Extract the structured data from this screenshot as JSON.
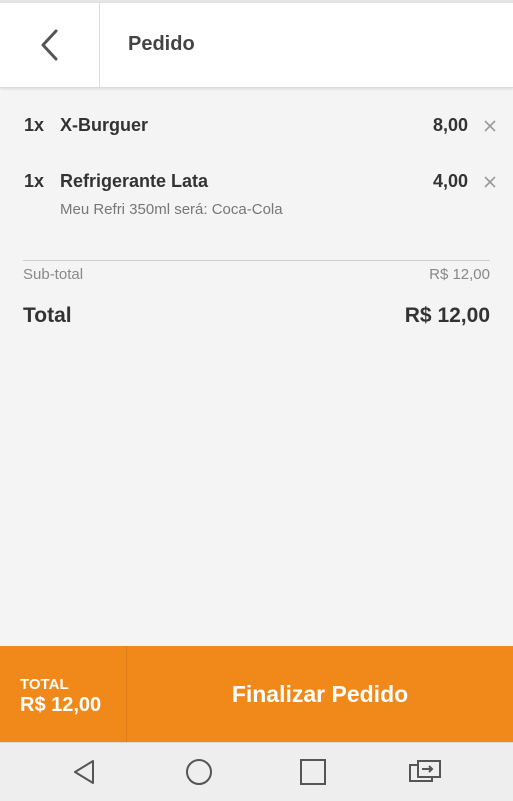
{
  "header": {
    "title": "Pedido"
  },
  "items": [
    {
      "qty": "1x",
      "name": "X-Burguer",
      "price": "8,00",
      "note": ""
    },
    {
      "qty": "1x",
      "name": "Refrigerante Lata",
      "price": "4,00",
      "note": "Meu Refri 350ml será: Coca-Cola"
    }
  ],
  "summary": {
    "subtotal_label": "Sub-total",
    "subtotal_value": "R$ 12,00",
    "total_label": "Total",
    "total_value": "R$ 12,00"
  },
  "footer": {
    "total_label": "TOTAL",
    "total_value": "R$ 12,00",
    "finalize_label": "Finalizar Pedido",
    "accent_color": "#f0891a"
  },
  "icons": {
    "back": "chevron-left-icon",
    "remove": "close-icon",
    "nav_back": "triangle-back-icon",
    "nav_home": "circle-home-icon",
    "nav_recent": "square-recent-icon",
    "nav_switch": "switch-apps-icon"
  }
}
